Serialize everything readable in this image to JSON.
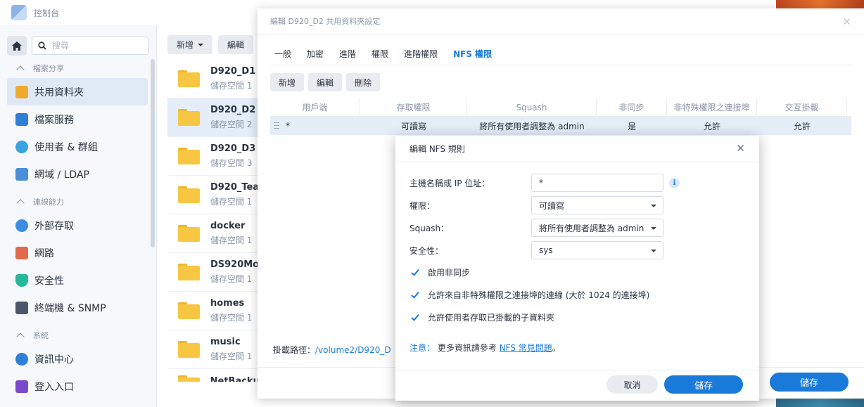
{
  "colors": {
    "accent": "#1a7ad9",
    "folder": "#f7c744",
    "selected_row": "#e4edf8"
  },
  "control_panel": {
    "title": "控制台",
    "search_placeholder": "搜尋"
  },
  "sidebar": {
    "sections": [
      {
        "label": "檔案分享",
        "items": [
          {
            "label": "共用資料夾",
            "icon": "shared-folder-icon",
            "active": true
          },
          {
            "label": "檔案服務",
            "icon": "file-services-icon"
          },
          {
            "label": "使用者 & 群組",
            "icon": "users-icon"
          },
          {
            "label": "網域 / LDAP",
            "icon": "domain-icon"
          }
        ]
      },
      {
        "label": "連線能力",
        "items": [
          {
            "label": "外部存取",
            "icon": "external-access-icon"
          },
          {
            "label": "網路",
            "icon": "network-icon"
          },
          {
            "label": "安全性",
            "icon": "security-icon"
          },
          {
            "label": "終端機 & SNMP",
            "icon": "terminal-icon"
          }
        ]
      },
      {
        "label": "系統",
        "items": [
          {
            "label": "資訊中心",
            "icon": "info-center-icon"
          },
          {
            "label": "登入入口",
            "icon": "login-portal-icon"
          }
        ]
      }
    ]
  },
  "share_list": {
    "toolbar": {
      "create": "新增",
      "edit": "編輯"
    },
    "rows": [
      {
        "name": "D920_D1",
        "sub": "儲存空間 1"
      },
      {
        "name": "D920_D2",
        "sub": "儲存空間 2",
        "selected": true
      },
      {
        "name": "D920_D3",
        "sub": "儲存空間 3"
      },
      {
        "name": "D920_Tea",
        "sub": "儲存空間 1"
      },
      {
        "name": "docker",
        "sub": "儲存空間 1"
      },
      {
        "name": "DS920Mo",
        "sub": "儲存空間 1"
      },
      {
        "name": "homes",
        "sub": "儲存空間 1"
      },
      {
        "name": "music",
        "sub": "儲存空間 1"
      },
      {
        "name": "NetBacku",
        "sub": ""
      }
    ]
  },
  "edit_dialog": {
    "title": "編輯 D920_D2 共用資料夾設定",
    "tabs": [
      "一般",
      "加密",
      "進階",
      "權限",
      "進階權限",
      "NFS 權限"
    ],
    "active_tab": "NFS 權限",
    "buttons": {
      "create": "新增",
      "edit": "編輯",
      "delete": "刪除"
    },
    "grid": {
      "headers": [
        "用戶端",
        "存取權限",
        "Squash",
        "非同步",
        "非特殊權限之連接埠",
        "交互掛載"
      ],
      "rows": [
        [
          "*",
          "可讀寫",
          "將所有使用者調整為 admin",
          "是",
          "允許",
          "允許"
        ]
      ]
    },
    "mount_path_label": "掛載路徑：",
    "mount_path": "/volume2/D920_D",
    "save": "儲存"
  },
  "nfs_rule_modal": {
    "title": "編輯 NFS 規則",
    "host_label": "主機名稱或 IP 位址：",
    "host_value": "*",
    "privilege_label": "權限：",
    "privilege_value": "可讀寫",
    "squash_label": "Squash：",
    "squash_value": "將所有使用者調整為 admin",
    "security_label": "安全性：",
    "security_value": "sys",
    "checkboxes": [
      {
        "label": "啟用非同步",
        "checked": true
      },
      {
        "label": "允許來自非特殊權限之連接埠的連線 (大於 1024 的連接埠)",
        "checked": true
      },
      {
        "label": "允許使用者存取已掛載的子資料夾",
        "checked": true
      }
    ],
    "note_label": "注意：",
    "note_text": "更多資訊請參考",
    "note_link": "NFS 常見問題",
    "note_end": "。",
    "cancel": "取消",
    "save": "儲存"
  }
}
